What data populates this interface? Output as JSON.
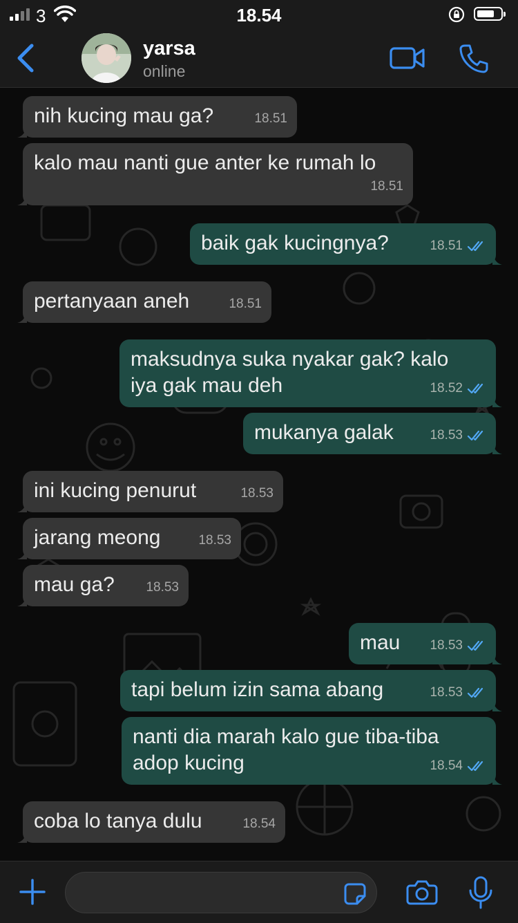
{
  "status_bar": {
    "carrier": "3",
    "time": "18.54"
  },
  "header": {
    "contact_name": "yarsa",
    "contact_status": "online",
    "icons": [
      "back-chevron-icon",
      "video-call-icon",
      "phone-icon"
    ]
  },
  "colors": {
    "accent": "#3b8df0",
    "incoming_bubble": "#363636",
    "outgoing_bubble": "#1f4b44",
    "read_tick": "#52a8f5"
  },
  "messages": [
    {
      "direction": "in",
      "lines": [
        "nih kucing mau ga?"
      ],
      "time": "18.51"
    },
    {
      "direction": "in",
      "lines": [
        "kalo mau nanti gue anter ke rumah lo"
      ],
      "time": "18.51"
    },
    {
      "direction": "out",
      "lines": [
        "baik gak kucingnya?"
      ],
      "time": "18.51",
      "read": true
    },
    {
      "direction": "in",
      "lines": [
        "pertanyaan aneh"
      ],
      "time": "18.51"
    },
    {
      "direction": "out",
      "lines": [
        "maksudnya suka nyakar gak? kalo",
        "iya gak mau deh"
      ],
      "time": "18.52",
      "read": true
    },
    {
      "direction": "out",
      "lines": [
        "mukanya galak"
      ],
      "time": "18.53",
      "read": true
    },
    {
      "direction": "in",
      "lines": [
        "ini kucing penurut"
      ],
      "time": "18.53"
    },
    {
      "direction": "in",
      "lines": [
        "jarang meong"
      ],
      "time": "18.53"
    },
    {
      "direction": "in",
      "lines": [
        "mau ga?"
      ],
      "time": "18.53"
    },
    {
      "direction": "out",
      "lines": [
        "mau"
      ],
      "time": "18.53",
      "read": true
    },
    {
      "direction": "out",
      "lines": [
        "tapi belum izin sama abang"
      ],
      "time": "18.53",
      "read": true
    },
    {
      "direction": "out",
      "lines": [
        "nanti dia marah kalo gue tiba-tiba",
        "adop kucing"
      ],
      "time": "18.54",
      "read": true
    },
    {
      "direction": "in",
      "lines": [
        "coba lo tanya dulu"
      ],
      "time": "18.54"
    }
  ],
  "input_bar": {
    "message_value": "",
    "icons": [
      "plus-icon",
      "sticker-icon",
      "camera-icon",
      "microphone-icon"
    ]
  }
}
